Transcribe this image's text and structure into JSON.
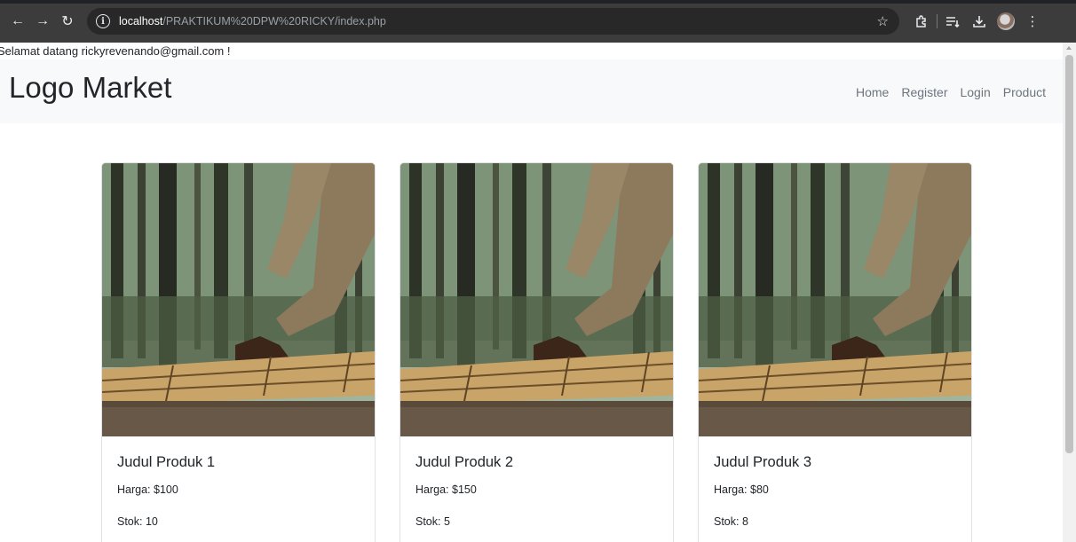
{
  "browser": {
    "url_host": "localhost",
    "url_path": "/PRAKTIKUM%20DPW%20RICKY/index.php"
  },
  "page": {
    "welcome": "Selamat datang rickyrevenando@gmail.com !",
    "brand": "Logo Market",
    "nav": [
      "Home",
      "Register",
      "Login",
      "Product"
    ]
  },
  "products": [
    {
      "title": "Judul Produk 1",
      "price": "Harga: $100",
      "stock": "Stok: 10"
    },
    {
      "title": "Judul Produk 2",
      "price": "Harga: $150",
      "stock": "Stok: 5"
    },
    {
      "title": "Judul Produk 3",
      "price": "Harga: $80",
      "stock": "Stok: 8"
    }
  ],
  "icons": [
    "back-arrow-icon",
    "forward-arrow-icon",
    "reload-icon",
    "site-info-icon",
    "bookmark-star-icon",
    "extensions-icon",
    "reading-list-icon",
    "download-icon",
    "profile-avatar",
    "menu-dots-icon"
  ],
  "colors": {
    "chrome": "#3c3c3c",
    "navbar": "#f8f9fa",
    "nav_link": "#6c757d",
    "text": "#212529"
  }
}
